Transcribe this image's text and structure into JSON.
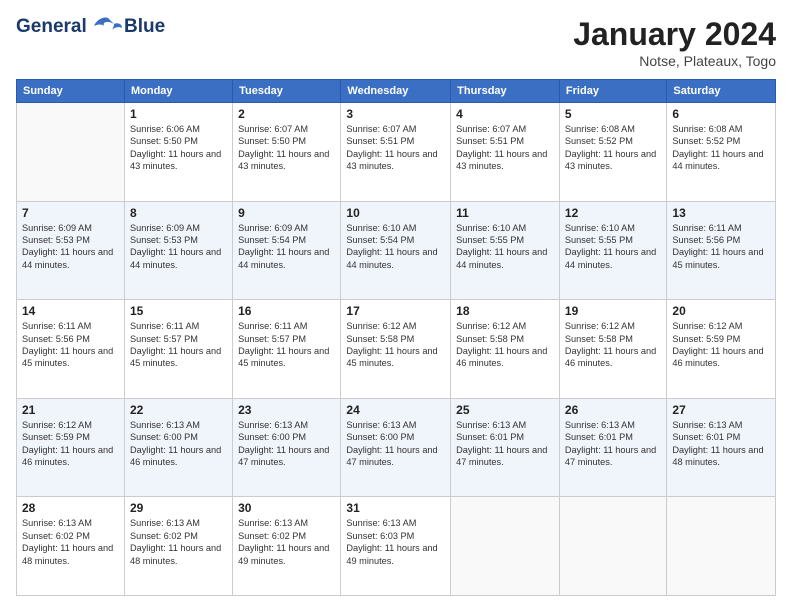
{
  "logo": {
    "line1": "General",
    "line2": "Blue"
  },
  "title": "January 2024",
  "subtitle": "Notse, Plateaux, Togo",
  "days_of_week": [
    "Sunday",
    "Monday",
    "Tuesday",
    "Wednesday",
    "Thursday",
    "Friday",
    "Saturday"
  ],
  "weeks": [
    [
      {
        "num": "",
        "sunrise": "",
        "sunset": "",
        "daylight": ""
      },
      {
        "num": "1",
        "sunrise": "Sunrise: 6:06 AM",
        "sunset": "Sunset: 5:50 PM",
        "daylight": "Daylight: 11 hours and 43 minutes."
      },
      {
        "num": "2",
        "sunrise": "Sunrise: 6:07 AM",
        "sunset": "Sunset: 5:50 PM",
        "daylight": "Daylight: 11 hours and 43 minutes."
      },
      {
        "num": "3",
        "sunrise": "Sunrise: 6:07 AM",
        "sunset": "Sunset: 5:51 PM",
        "daylight": "Daylight: 11 hours and 43 minutes."
      },
      {
        "num": "4",
        "sunrise": "Sunrise: 6:07 AM",
        "sunset": "Sunset: 5:51 PM",
        "daylight": "Daylight: 11 hours and 43 minutes."
      },
      {
        "num": "5",
        "sunrise": "Sunrise: 6:08 AM",
        "sunset": "Sunset: 5:52 PM",
        "daylight": "Daylight: 11 hours and 43 minutes."
      },
      {
        "num": "6",
        "sunrise": "Sunrise: 6:08 AM",
        "sunset": "Sunset: 5:52 PM",
        "daylight": "Daylight: 11 hours and 44 minutes."
      }
    ],
    [
      {
        "num": "7",
        "sunrise": "Sunrise: 6:09 AM",
        "sunset": "Sunset: 5:53 PM",
        "daylight": "Daylight: 11 hours and 44 minutes."
      },
      {
        "num": "8",
        "sunrise": "Sunrise: 6:09 AM",
        "sunset": "Sunset: 5:53 PM",
        "daylight": "Daylight: 11 hours and 44 minutes."
      },
      {
        "num": "9",
        "sunrise": "Sunrise: 6:09 AM",
        "sunset": "Sunset: 5:54 PM",
        "daylight": "Daylight: 11 hours and 44 minutes."
      },
      {
        "num": "10",
        "sunrise": "Sunrise: 6:10 AM",
        "sunset": "Sunset: 5:54 PM",
        "daylight": "Daylight: 11 hours and 44 minutes."
      },
      {
        "num": "11",
        "sunrise": "Sunrise: 6:10 AM",
        "sunset": "Sunset: 5:55 PM",
        "daylight": "Daylight: 11 hours and 44 minutes."
      },
      {
        "num": "12",
        "sunrise": "Sunrise: 6:10 AM",
        "sunset": "Sunset: 5:55 PM",
        "daylight": "Daylight: 11 hours and 44 minutes."
      },
      {
        "num": "13",
        "sunrise": "Sunrise: 6:11 AM",
        "sunset": "Sunset: 5:56 PM",
        "daylight": "Daylight: 11 hours and 45 minutes."
      }
    ],
    [
      {
        "num": "14",
        "sunrise": "Sunrise: 6:11 AM",
        "sunset": "Sunset: 5:56 PM",
        "daylight": "Daylight: 11 hours and 45 minutes."
      },
      {
        "num": "15",
        "sunrise": "Sunrise: 6:11 AM",
        "sunset": "Sunset: 5:57 PM",
        "daylight": "Daylight: 11 hours and 45 minutes."
      },
      {
        "num": "16",
        "sunrise": "Sunrise: 6:11 AM",
        "sunset": "Sunset: 5:57 PM",
        "daylight": "Daylight: 11 hours and 45 minutes."
      },
      {
        "num": "17",
        "sunrise": "Sunrise: 6:12 AM",
        "sunset": "Sunset: 5:58 PM",
        "daylight": "Daylight: 11 hours and 45 minutes."
      },
      {
        "num": "18",
        "sunrise": "Sunrise: 6:12 AM",
        "sunset": "Sunset: 5:58 PM",
        "daylight": "Daylight: 11 hours and 46 minutes."
      },
      {
        "num": "19",
        "sunrise": "Sunrise: 6:12 AM",
        "sunset": "Sunset: 5:58 PM",
        "daylight": "Daylight: 11 hours and 46 minutes."
      },
      {
        "num": "20",
        "sunrise": "Sunrise: 6:12 AM",
        "sunset": "Sunset: 5:59 PM",
        "daylight": "Daylight: 11 hours and 46 minutes."
      }
    ],
    [
      {
        "num": "21",
        "sunrise": "Sunrise: 6:12 AM",
        "sunset": "Sunset: 5:59 PM",
        "daylight": "Daylight: 11 hours and 46 minutes."
      },
      {
        "num": "22",
        "sunrise": "Sunrise: 6:13 AM",
        "sunset": "Sunset: 6:00 PM",
        "daylight": "Daylight: 11 hours and 46 minutes."
      },
      {
        "num": "23",
        "sunrise": "Sunrise: 6:13 AM",
        "sunset": "Sunset: 6:00 PM",
        "daylight": "Daylight: 11 hours and 47 minutes."
      },
      {
        "num": "24",
        "sunrise": "Sunrise: 6:13 AM",
        "sunset": "Sunset: 6:00 PM",
        "daylight": "Daylight: 11 hours and 47 minutes."
      },
      {
        "num": "25",
        "sunrise": "Sunrise: 6:13 AM",
        "sunset": "Sunset: 6:01 PM",
        "daylight": "Daylight: 11 hours and 47 minutes."
      },
      {
        "num": "26",
        "sunrise": "Sunrise: 6:13 AM",
        "sunset": "Sunset: 6:01 PM",
        "daylight": "Daylight: 11 hours and 47 minutes."
      },
      {
        "num": "27",
        "sunrise": "Sunrise: 6:13 AM",
        "sunset": "Sunset: 6:01 PM",
        "daylight": "Daylight: 11 hours and 48 minutes."
      }
    ],
    [
      {
        "num": "28",
        "sunrise": "Sunrise: 6:13 AM",
        "sunset": "Sunset: 6:02 PM",
        "daylight": "Daylight: 11 hours and 48 minutes."
      },
      {
        "num": "29",
        "sunrise": "Sunrise: 6:13 AM",
        "sunset": "Sunset: 6:02 PM",
        "daylight": "Daylight: 11 hours and 48 minutes."
      },
      {
        "num": "30",
        "sunrise": "Sunrise: 6:13 AM",
        "sunset": "Sunset: 6:02 PM",
        "daylight": "Daylight: 11 hours and 49 minutes."
      },
      {
        "num": "31",
        "sunrise": "Sunrise: 6:13 AM",
        "sunset": "Sunset: 6:03 PM",
        "daylight": "Daylight: 11 hours and 49 minutes."
      },
      {
        "num": "",
        "sunrise": "",
        "sunset": "",
        "daylight": ""
      },
      {
        "num": "",
        "sunrise": "",
        "sunset": "",
        "daylight": ""
      },
      {
        "num": "",
        "sunrise": "",
        "sunset": "",
        "daylight": ""
      }
    ]
  ]
}
